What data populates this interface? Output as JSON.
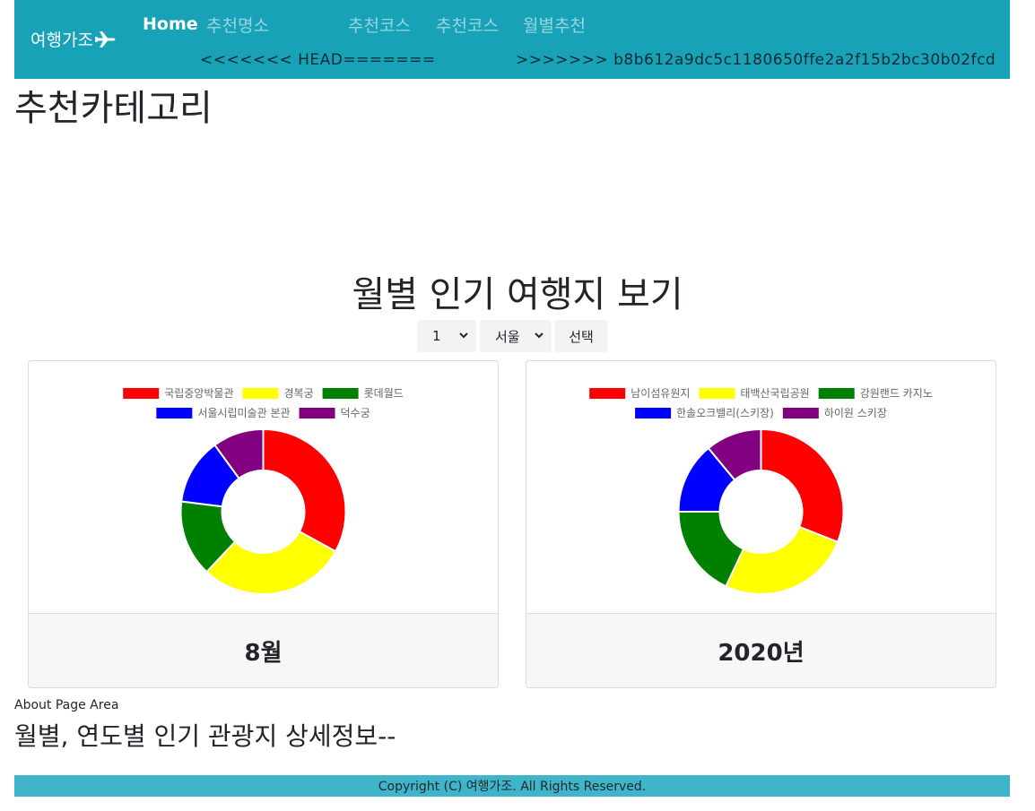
{
  "navbar": {
    "brand": "여행가조",
    "links": [
      {
        "label": "Home"
      },
      {
        "label": "추천명소"
      },
      {
        "label": "추천코스"
      },
      {
        "label": "추천코스"
      },
      {
        "label": "월별추천"
      }
    ],
    "merge_head": "<<<<<<< HEAD=======",
    "merge_tail": ">>>>>>> b8b612a9dc5c1180650ffe2a2f15b2bc30b02fcd",
    "bg_color": "#17a2b8"
  },
  "category_title": "추천카테고리",
  "section_title": "월별 인기 여행지 보기",
  "controls": {
    "month_select": "1",
    "region_select": "서울",
    "select_button": "선택"
  },
  "cards": [
    {
      "footer": "8월",
      "chart_data": {
        "type": "pie",
        "donut": true,
        "legend_position": "top",
        "labels": [
          "국립중앙박물관",
          "경복궁",
          "롯데월드",
          "서울시립미술관 본관",
          "덕수궁"
        ],
        "values": [
          33,
          29,
          15,
          13,
          10
        ],
        "colors": [
          "#ff0000",
          "#ffff00",
          "#008000",
          "#0000ff",
          "#800080"
        ]
      }
    },
    {
      "footer": "2020년",
      "chart_data": {
        "type": "pie",
        "donut": true,
        "legend_position": "top",
        "labels": [
          "남이섬유원지",
          "태백산국립공원",
          "강원랜드 카지노",
          "한솔오크밸리(스키장)",
          "하이원 스키장"
        ],
        "values": [
          31,
          26,
          18,
          14,
          11
        ],
        "colors": [
          "#ff0000",
          "#ffff00",
          "#008000",
          "#0000ff",
          "#800080"
        ]
      }
    }
  ],
  "about_label": "About Page Area",
  "detail_title": "월별, 연도별 인기 관광지 상세정보--",
  "footer_text": "Copyright (C) 여행가조. All Rights Reserved."
}
